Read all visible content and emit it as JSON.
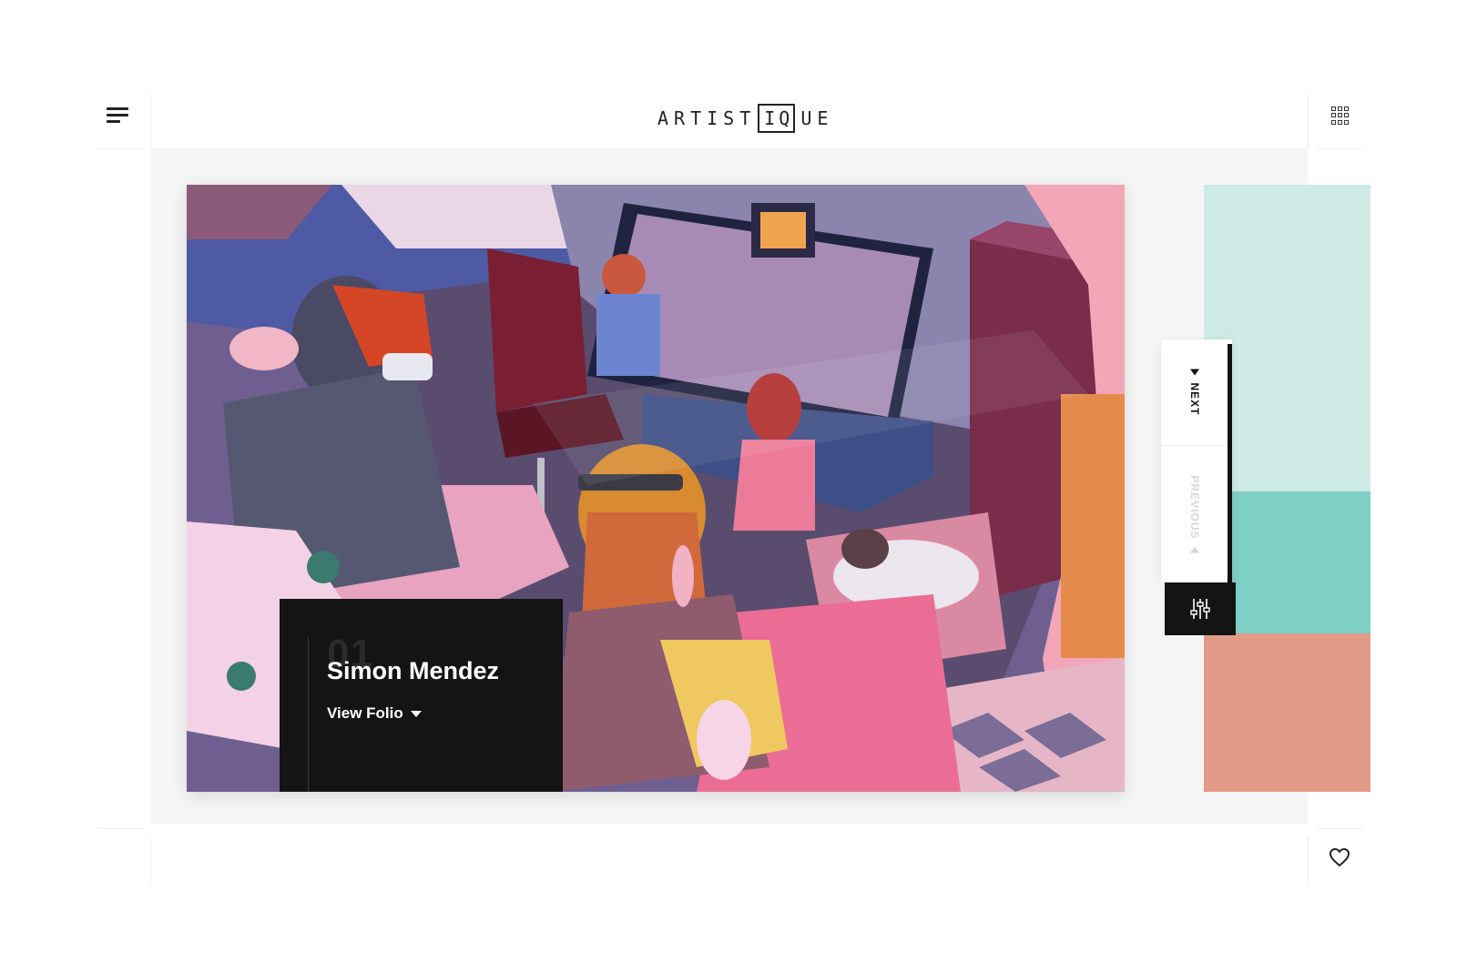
{
  "header": {
    "logo_left": "ARTIST",
    "logo_boxed": "IQ",
    "logo_right": "UE",
    "menu_icon": "hamburger-menu-icon",
    "grid_icon": "grid-view-icon"
  },
  "feature": {
    "index": "01",
    "artist_name": "Simon Mendez",
    "view_folio_label": "View Folio"
  },
  "navigation": {
    "next_label": "NEXT",
    "previous_label": "PREVIOUS",
    "filter_icon": "sliders-filter-icon"
  },
  "footer": {
    "favorite_icon": "heart-icon"
  },
  "colors": {
    "caption_bg": "#141414",
    "preview_top": "#cdeae4",
    "preview_mid": "#7ecfc5",
    "preview_bottom": "#e39b88"
  }
}
